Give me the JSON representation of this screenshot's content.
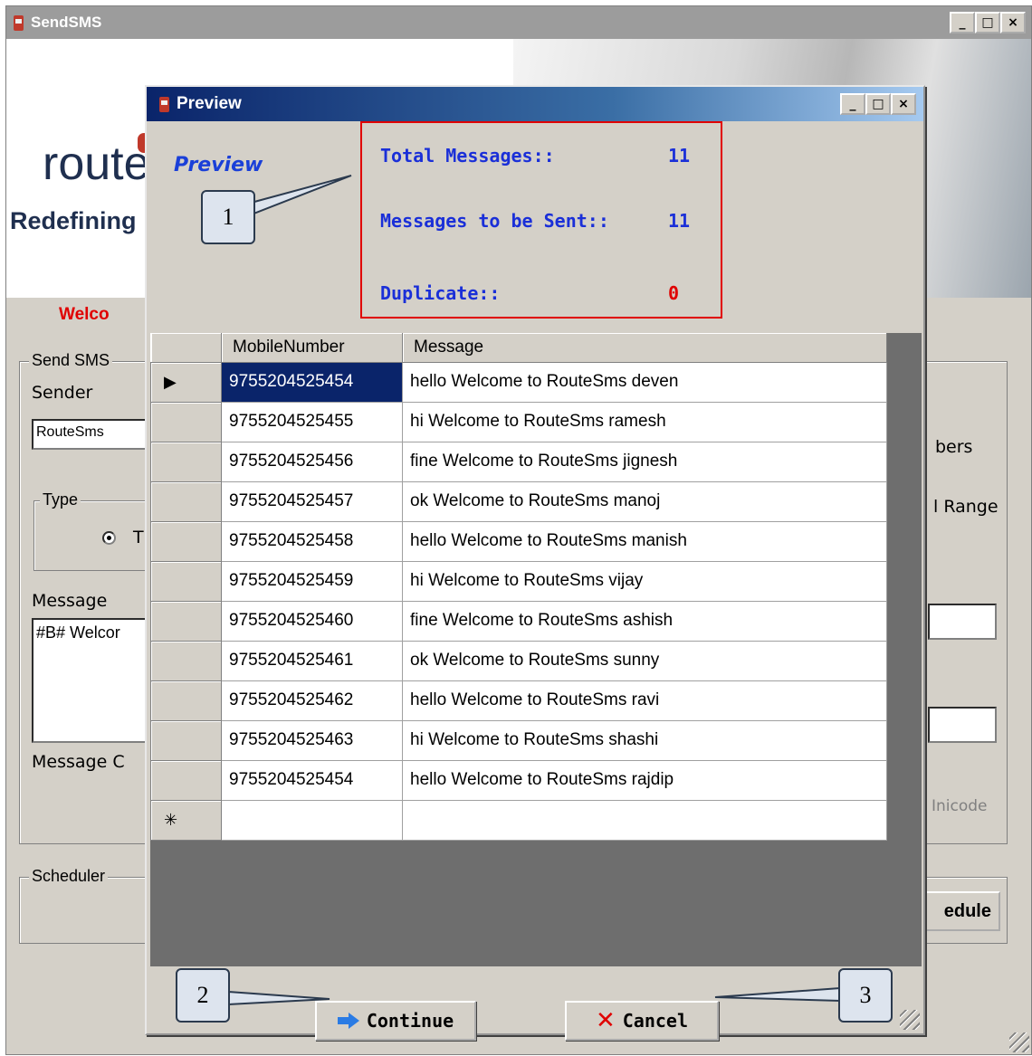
{
  "bg_window": {
    "title": "SendSMS",
    "controls": [
      "_",
      "□",
      "×"
    ],
    "banner": {
      "logo_text": "route",
      "tagline": "Redefining"
    },
    "welcome": "Welco",
    "send_sms_group": "Send SMS",
    "sender_label": "Sender",
    "sender_value": "RouteSms",
    "type_group": "Type",
    "type_radio_label": "T",
    "message_label": "Message",
    "message_value": "#B# Welcor",
    "message_count_label": "Message C",
    "right_labels": {
      "numbers": "bers",
      "range": "l Range",
      "unicode": "Inicode"
    },
    "scheduler_group": "Scheduler",
    "schedule_button": "edule"
  },
  "dialog": {
    "title": "Preview",
    "controls": [
      "_",
      "□",
      "×"
    ],
    "heading": "Preview",
    "stats": [
      {
        "label": "Total Messages::",
        "value": "11",
        "color": "#1a2fd8"
      },
      {
        "label": "Messages to be Sent::",
        "value": "11",
        "color": "#1a2fd8"
      },
      {
        "label": "Duplicate::",
        "value": "0",
        "color": "#e00000"
      }
    ],
    "grid": {
      "columns": [
        "MobileNumber",
        "Message"
      ],
      "rows": [
        {
          "number": "9755204525454",
          "message": "hello Welcome to RouteSms deven"
        },
        {
          "number": "9755204525455",
          "message": "hi Welcome to RouteSms ramesh"
        },
        {
          "number": "9755204525456",
          "message": "fine Welcome to RouteSms jignesh"
        },
        {
          "number": "9755204525457",
          "message": "ok Welcome to RouteSms manoj"
        },
        {
          "number": "9755204525458",
          "message": "hello Welcome to RouteSms manish"
        },
        {
          "number": "9755204525459",
          "message": "hi Welcome to RouteSms vijay"
        },
        {
          "number": "9755204525460",
          "message": "fine Welcome to RouteSms ashish"
        },
        {
          "number": "9755204525461",
          "message": "ok Welcome to RouteSms sunny"
        },
        {
          "number": "9755204525462",
          "message": "hello Welcome to RouteSms ravi"
        },
        {
          "number": "9755204525463",
          "message": "hi Welcome to RouteSms shashi"
        },
        {
          "number": "9755204525454",
          "message": "hello Welcome to RouteSms rajdip"
        }
      ],
      "current_row_marker": "▶",
      "new_row_marker": "✳"
    },
    "continue_button": "Continue",
    "cancel_button": "Cancel"
  },
  "callouts": [
    "1",
    "2",
    "3"
  ]
}
